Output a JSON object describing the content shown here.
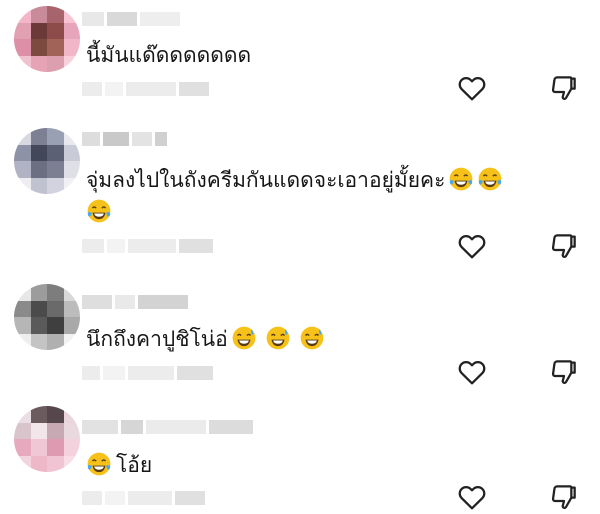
{
  "comments": [
    {
      "text": "นี้มันแด๊ดดดดดดด",
      "emoji_names": [],
      "emoji_label": ""
    },
    {
      "text": "จุ่มลงไปในถังครีมกันแดดจะเอาอยู่มั้ยคะ",
      "emoji_names": [
        "laugh-tears-emoji",
        "laugh-tears-emoji",
        "laugh-tears-emoji"
      ]
    },
    {
      "text": "นึกถึงคาปูชิโน่อ่",
      "emoji_names": [
        "sweat-smile-emoji",
        "sweat-smile-emoji",
        "sweat-smile-emoji"
      ]
    },
    {
      "text": "โอ้ย",
      "emoji_names": [
        "laugh-tears-emoji"
      ]
    }
  ],
  "icons": {
    "like": "heart-outline-icon",
    "dislike": "thumbs-down-outline-icon"
  },
  "colors": {
    "text": "#161616",
    "icon": "#222222",
    "blur": "#ececec",
    "emoji": "#f6c21a"
  }
}
